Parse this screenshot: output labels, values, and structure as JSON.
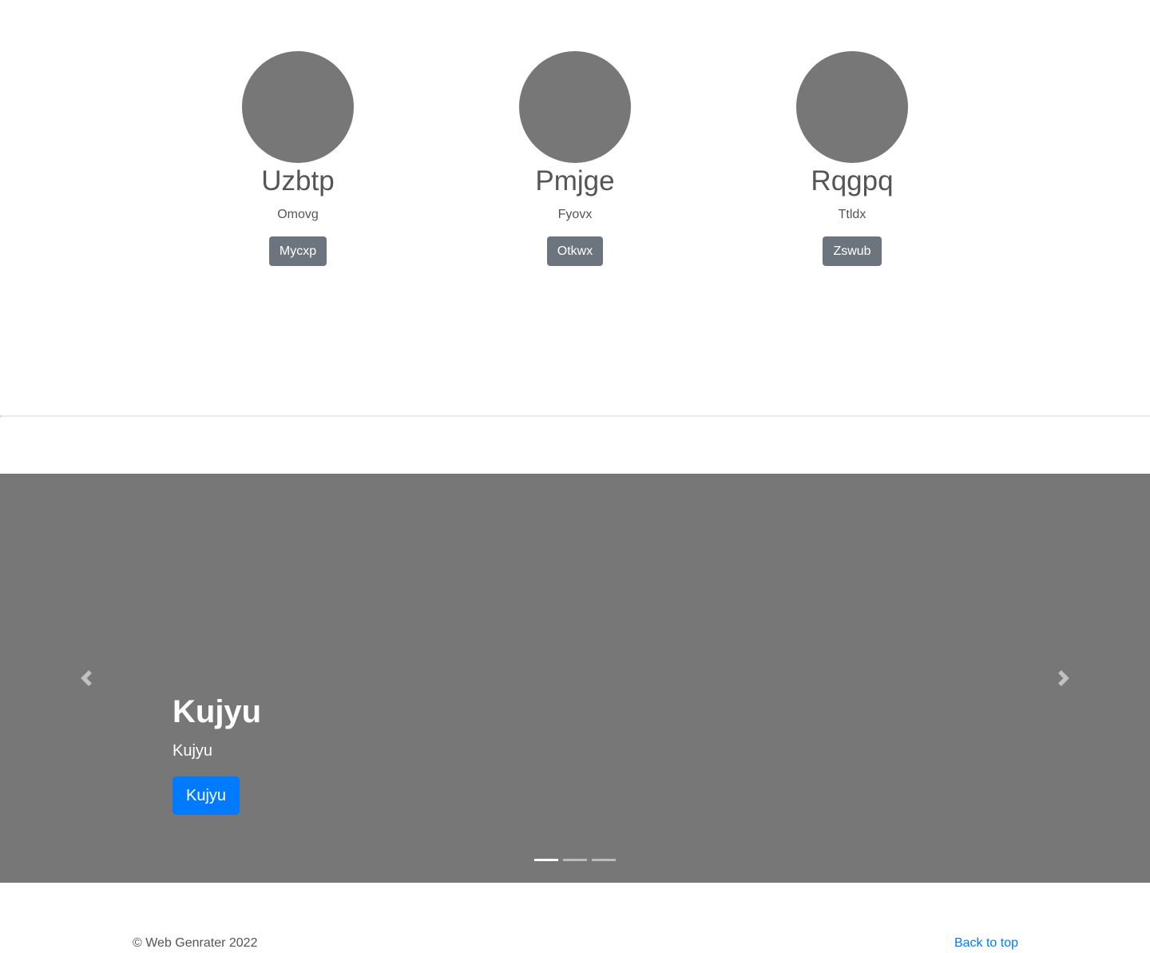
{
  "profiles": [
    {
      "name": "Uzbtp",
      "description": "Omovg",
      "button_label": "Mycxp"
    },
    {
      "name": "Pmjge",
      "description": "Fyovx",
      "button_label": "Otkwx"
    },
    {
      "name": "Rqgpq",
      "description": "Ttldx",
      "button_label": "Zswub"
    }
  ],
  "carousel": {
    "title": "Kujyu",
    "text": "Kujyu",
    "button_label": "Kujyu",
    "prev_icon": "chevron-left-icon",
    "next_icon": "chevron-right-icon",
    "indicator_count": 3,
    "active_indicator": 1,
    "background_color": "#777777",
    "button_color": "#007bff"
  },
  "footer": {
    "copyright": "© Web Genrater 2022",
    "back_to_top": "Back to top"
  }
}
